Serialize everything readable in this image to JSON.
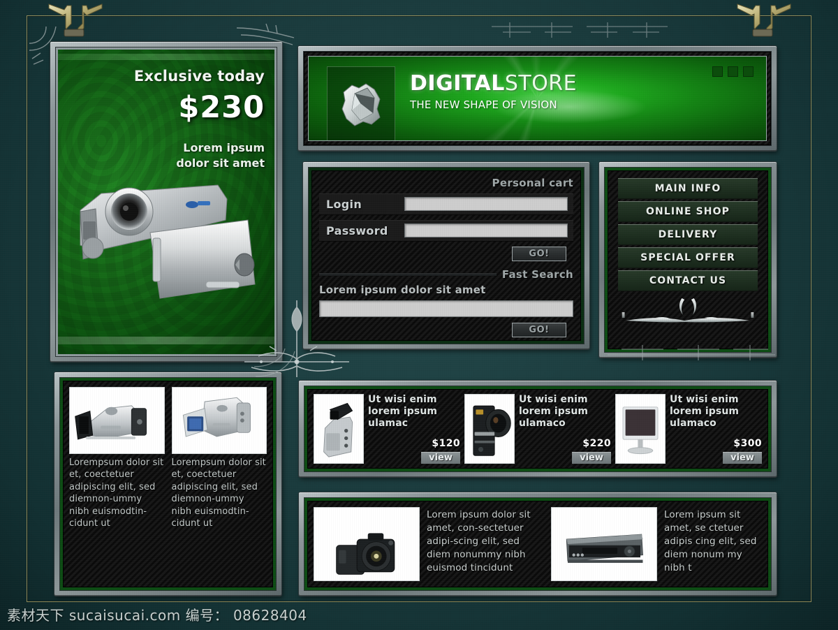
{
  "site": {
    "brand_primary": "DIGITAL",
    "brand_secondary": "STORE",
    "tagline": "THE NEW SHAPE OF  VISION",
    "logo_icon": "gear-cube-logo-icon",
    "accent_green": "#1ea81e",
    "panel_green": "#0d4c14",
    "metal_grey": "#8b9598",
    "background_teal": "#1b3c3e",
    "gold_line": "#8f8b5a"
  },
  "promo": {
    "title": "Exclusive today",
    "price": "$230",
    "subtitle_line1": "Lorem ipsum",
    "subtitle_line2": "dolor sit amet",
    "product_icon": "camcorder-silver-icon"
  },
  "cart": {
    "heading": "Personal cart",
    "login_label": "Login",
    "login_value": "",
    "login_placeholder": "",
    "password_label": "Password",
    "password_value": "",
    "password_placeholder": "",
    "go_label": "GO!"
  },
  "search": {
    "heading": "Fast Search",
    "hint": "Lorem ipsum dolor sit amet",
    "value": "",
    "placeholder": "",
    "go_label": "GO!"
  },
  "menu": {
    "items": [
      {
        "label": "MAIN INFO"
      },
      {
        "label": "ONLINE SHOP"
      },
      {
        "label": "DELIVERY"
      },
      {
        "label": "SPECIAL OFFER"
      },
      {
        "label": "CONTACT US"
      }
    ],
    "ornament_icon": "silver-filigree-ornament-icon"
  },
  "featured_columns": [
    {
      "image_icon": "camcorder-open-lcd-icon",
      "text": "Lorempsum dolor sit et, coectetuer adipiscing elit, sed diemnon-ummy nibh euismodtin-cidunt ut"
    },
    {
      "image_icon": "camcorder-blue-lcd-icon",
      "text": "Lorempsum dolor sit et, coectetuer adipiscing elit, sed diemnon-ummy nibh euismodtin-cidunt ut"
    }
  ],
  "products": [
    {
      "image_icon": "camcorder-viewfinder-icon",
      "title": "Ut wisi enim lorem ipsum ulamac",
      "price": "$120",
      "view_label": "view"
    },
    {
      "image_icon": "video-camera-black-icon",
      "title": "Ut wisi enim lorem ipsum ulamaco",
      "price": "$220",
      "view_label": "view"
    },
    {
      "image_icon": "lcd-monitor-icon",
      "title": "Ut wisi enim lorem ipsum ulamaco",
      "price": "$300",
      "view_label": "view"
    }
  ],
  "descriptions": [
    {
      "image_icon": "dslr-camera-icon",
      "text": "Lorem ipsum dolor sit amet, con-sectetuer adipi-scing elit, sed diem nonummy nibh euismod tincidunt"
    },
    {
      "image_icon": "vcr-deck-icon",
      "text": "Lorem ipsum  sit amet, se ctetuer adipis cing elit, sed diem nonum my nibh t"
    }
  ],
  "watermark": {
    "text": "素材天下 sucaisucai.com  编号： 08628404"
  }
}
